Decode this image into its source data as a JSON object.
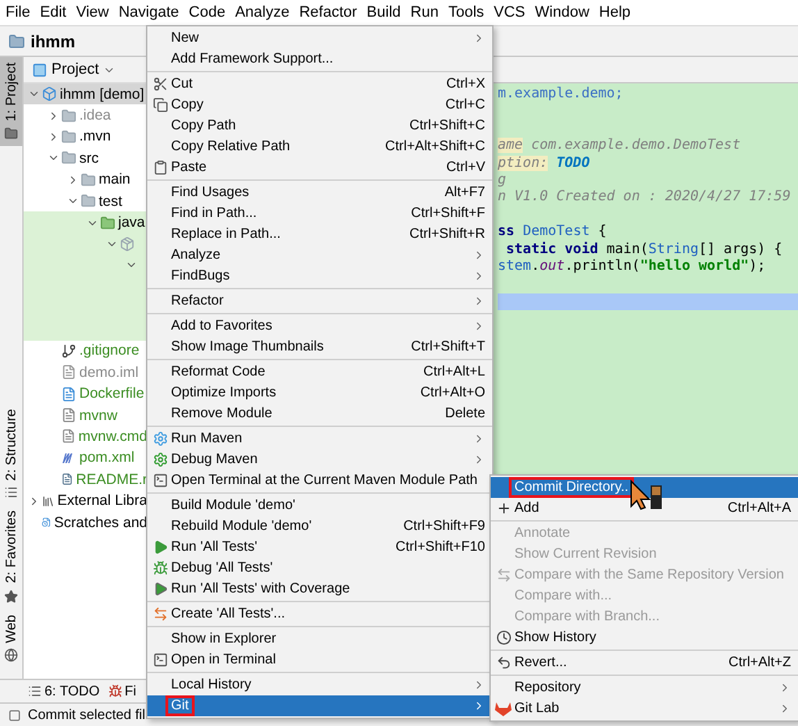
{
  "menu_bar": [
    "File",
    "Edit",
    "View",
    "Navigate",
    "Code",
    "Analyze",
    "Refactor",
    "Build",
    "Run",
    "Tools",
    "VCS",
    "Window",
    "Help"
  ],
  "project_title": "ihmm",
  "tool_stripe": [
    {
      "label": "1: Project",
      "kind": "project",
      "selected": true
    },
    {
      "label": "2: Structure",
      "kind": "structure",
      "selected": false
    },
    {
      "label": "2: Favorites",
      "kind": "favorites",
      "selected": false
    },
    {
      "label": "Web",
      "kind": "web",
      "selected": false
    }
  ],
  "project_panel": {
    "header": "Project",
    "tree": [
      {
        "label": "ihmm [demo]",
        "kind": "module",
        "expanded": true,
        "selected": true,
        "children": [
          {
            "label": ".idea",
            "kind": "folder",
            "color": "#8a8a8a",
            "expanded": false
          },
          {
            "label": ".mvn",
            "kind": "folder",
            "expanded": false
          },
          {
            "label": "src",
            "kind": "folder",
            "expanded": true,
            "children": [
              {
                "label": "main",
                "kind": "folder",
                "expanded": false
              },
              {
                "label": "test",
                "kind": "folder",
                "expanded": true,
                "children": [
                  {
                    "label": "java",
                    "kind": "testfolder",
                    "expanded": true,
                    "highlighted": true,
                    "children": [
                      {
                        "kind": "package",
                        "expanded": true,
                        "highlighted": true,
                        "children": [
                          {
                            "expanded": true,
                            "highlighted": true,
                            "children": [
                              {
                                "highlighted": true
                              },
                              {
                                "highlighted": true
                              },
                              {
                                "highlighted": true
                              }
                            ]
                          }
                        ]
                      }
                    ]
                  }
                ]
              }
            ]
          },
          {
            "label": ".gitignore",
            "kind": "git",
            "color": "#3b8d22"
          },
          {
            "label": "demo.iml",
            "kind": "iml",
            "color": "#8a8a8a"
          },
          {
            "label": "Dockerfile",
            "kind": "docker",
            "color": "#3b8d22"
          },
          {
            "label": "mvnw",
            "kind": "file",
            "color": "#3b8d22"
          },
          {
            "label": "mvnw.cmd",
            "kind": "file",
            "color": "#3b8d22"
          },
          {
            "label": "pom.xml",
            "kind": "maven",
            "color": "#3b8d22"
          },
          {
            "label": "README.r",
            "kind": "markdown",
            "color": "#3b8d22"
          }
        ]
      },
      {
        "label": "External Libra",
        "kind": "libraries",
        "expanded": false
      },
      {
        "label": "Scratches and",
        "kind": "scratches"
      }
    ]
  },
  "editor": {
    "lines": [
      {
        "segments": [
          {
            "text": "m.example.demo;",
            "kind": "package"
          }
        ]
      },
      {
        "current": false
      },
      {
        "current": false
      },
      {
        "segments": [
          {
            "text": "ame",
            "kind": "doctag"
          },
          {
            "text": " com.example.demo.DemoTest",
            "kind": "doc"
          }
        ]
      },
      {
        "segments": [
          {
            "text": "ption:",
            "kind": "doctag"
          },
          {
            "text": " TODO",
            "kind": "todo"
          }
        ]
      },
      {
        "segments": [
          {
            "text": "g",
            "kind": "doc"
          }
        ]
      },
      {
        "segments": [
          {
            "text": "n V1.0 Created on : 2020/4/27 17:59",
            "kind": "doc"
          }
        ]
      },
      {
        "current": false
      },
      {
        "segments": [
          {
            "text": "ss",
            "kind": "keyword"
          },
          {
            "text": " DemoTest",
            "kind": "type"
          },
          {
            "text": " {",
            "kind": "brace"
          }
        ]
      },
      {
        "segments": [
          {
            "text": " static void",
            "kind": "keyword"
          },
          {
            "text": " main(",
            "kind": "plain"
          },
          {
            "text": "String",
            "kind": "type"
          },
          {
            "text": "[] args) {",
            "kind": "plain"
          }
        ]
      },
      {
        "segments": [
          {
            "text": "stem",
            "kind": "type"
          },
          {
            "text": ".",
            "kind": "plain"
          },
          {
            "text": "out",
            "kind": "field"
          },
          {
            "text": ".println(",
            "kind": "plain"
          },
          {
            "text": "\"hello world\"",
            "kind": "string"
          },
          {
            "text": ");",
            "kind": "plain"
          }
        ]
      },
      {
        "current": false
      },
      {
        "current": true
      }
    ]
  },
  "bottom_tabs": [
    {
      "label": "6: TODO",
      "kind": "todo"
    },
    {
      "label": "Fi",
      "kind": "bugs"
    }
  ],
  "status_bar": "Commit selected fil",
  "context_menu": [
    {
      "kind": "item",
      "label": "New",
      "submenu": true
    },
    {
      "kind": "item",
      "label": "Add Framework Support..."
    },
    {
      "kind": "separator"
    },
    {
      "kind": "cut",
      "label": "Cut",
      "shortcut": "Ctrl+X"
    },
    {
      "kind": "copy",
      "label": "Copy",
      "shortcut": "Ctrl+C"
    },
    {
      "kind": "item",
      "label": "Copy Path",
      "shortcut": "Ctrl+Shift+C"
    },
    {
      "kind": "item",
      "label": "Copy Relative Path",
      "shortcut": "Ctrl+Alt+Shift+C"
    },
    {
      "kind": "paste",
      "label": "Paste",
      "shortcut": "Ctrl+V"
    },
    {
      "kind": "separator"
    },
    {
      "kind": "item",
      "label": "Find Usages",
      "shortcut": "Alt+F7"
    },
    {
      "kind": "item",
      "label": "Find in Path...",
      "shortcut": "Ctrl+Shift+F"
    },
    {
      "kind": "item",
      "label": "Replace in Path...",
      "shortcut": "Ctrl+Shift+R"
    },
    {
      "kind": "item",
      "label": "Analyze",
      "submenu": true
    },
    {
      "kind": "item",
      "label": "FindBugs",
      "submenu": true
    },
    {
      "kind": "separator"
    },
    {
      "kind": "item",
      "label": "Refactor",
      "submenu": true
    },
    {
      "kind": "separator"
    },
    {
      "kind": "item",
      "label": "Add to Favorites",
      "submenu": true
    },
    {
      "kind": "item",
      "label": "Show Image Thumbnails",
      "shortcut": "Ctrl+Shift+T"
    },
    {
      "kind": "separator"
    },
    {
      "kind": "item",
      "label": "Reformat Code",
      "shortcut": "Ctrl+Alt+L"
    },
    {
      "kind": "item",
      "label": "Optimize Imports",
      "shortcut": "Ctrl+Alt+O"
    },
    {
      "kind": "item",
      "label": "Remove Module",
      "shortcut": "Delete"
    },
    {
      "kind": "separator"
    },
    {
      "kind": "mavenrun",
      "label": "Run Maven",
      "submenu": true
    },
    {
      "kind": "mavendebug",
      "label": "Debug Maven",
      "submenu": true
    },
    {
      "kind": "terminal",
      "label": "Open Terminal at the Current Maven Module Path"
    },
    {
      "kind": "separator"
    },
    {
      "kind": "item",
      "label": "Build Module 'demo'"
    },
    {
      "kind": "item",
      "label": "Rebuild Module 'demo'",
      "shortcut": "Ctrl+Shift+F9"
    },
    {
      "kind": "run",
      "label": "Run 'All Tests'",
      "shortcut": "Ctrl+Shift+F10"
    },
    {
      "kind": "debug",
      "label": "Debug 'All Tests'"
    },
    {
      "kind": "coverage",
      "label": "Run 'All Tests' with Coverage"
    },
    {
      "kind": "separator"
    },
    {
      "kind": "createtest",
      "label": "Create 'All Tests'..."
    },
    {
      "kind": "separator"
    },
    {
      "kind": "item",
      "label": "Show in Explorer"
    },
    {
      "kind": "terminal",
      "label": "Open in Terminal"
    },
    {
      "kind": "separator"
    },
    {
      "kind": "item",
      "label": "Local History",
      "submenu": true
    },
    {
      "kind": "item",
      "label": "Git",
      "submenu": true,
      "selected": true,
      "outlined": true
    }
  ],
  "git_submenu": [
    {
      "kind": "item",
      "label": "Commit Directory..",
      "selected": true,
      "outlined": true
    },
    {
      "kind": "add",
      "label": "Add",
      "shortcut": "Ctrl+Alt+A"
    },
    {
      "kind": "separator"
    },
    {
      "kind": "item",
      "label": "Annotate",
      "disabled": true
    },
    {
      "kind": "item",
      "label": "Show Current Revision",
      "disabled": true
    },
    {
      "kind": "compare",
      "label": "Compare with the Same Repository Version",
      "disabled": true
    },
    {
      "kind": "item",
      "label": "Compare with...",
      "disabled": true
    },
    {
      "kind": "item",
      "label": "Compare with Branch...",
      "disabled": true
    },
    {
      "kind": "history",
      "label": "Show History"
    },
    {
      "kind": "separator"
    },
    {
      "kind": "revert",
      "label": "Revert...",
      "shortcut": "Ctrl+Alt+Z"
    },
    {
      "kind": "separator"
    },
    {
      "kind": "item",
      "label": "Repository",
      "submenu": true
    },
    {
      "kind": "gitlab",
      "label": "Git Lab",
      "submenu": true
    }
  ]
}
